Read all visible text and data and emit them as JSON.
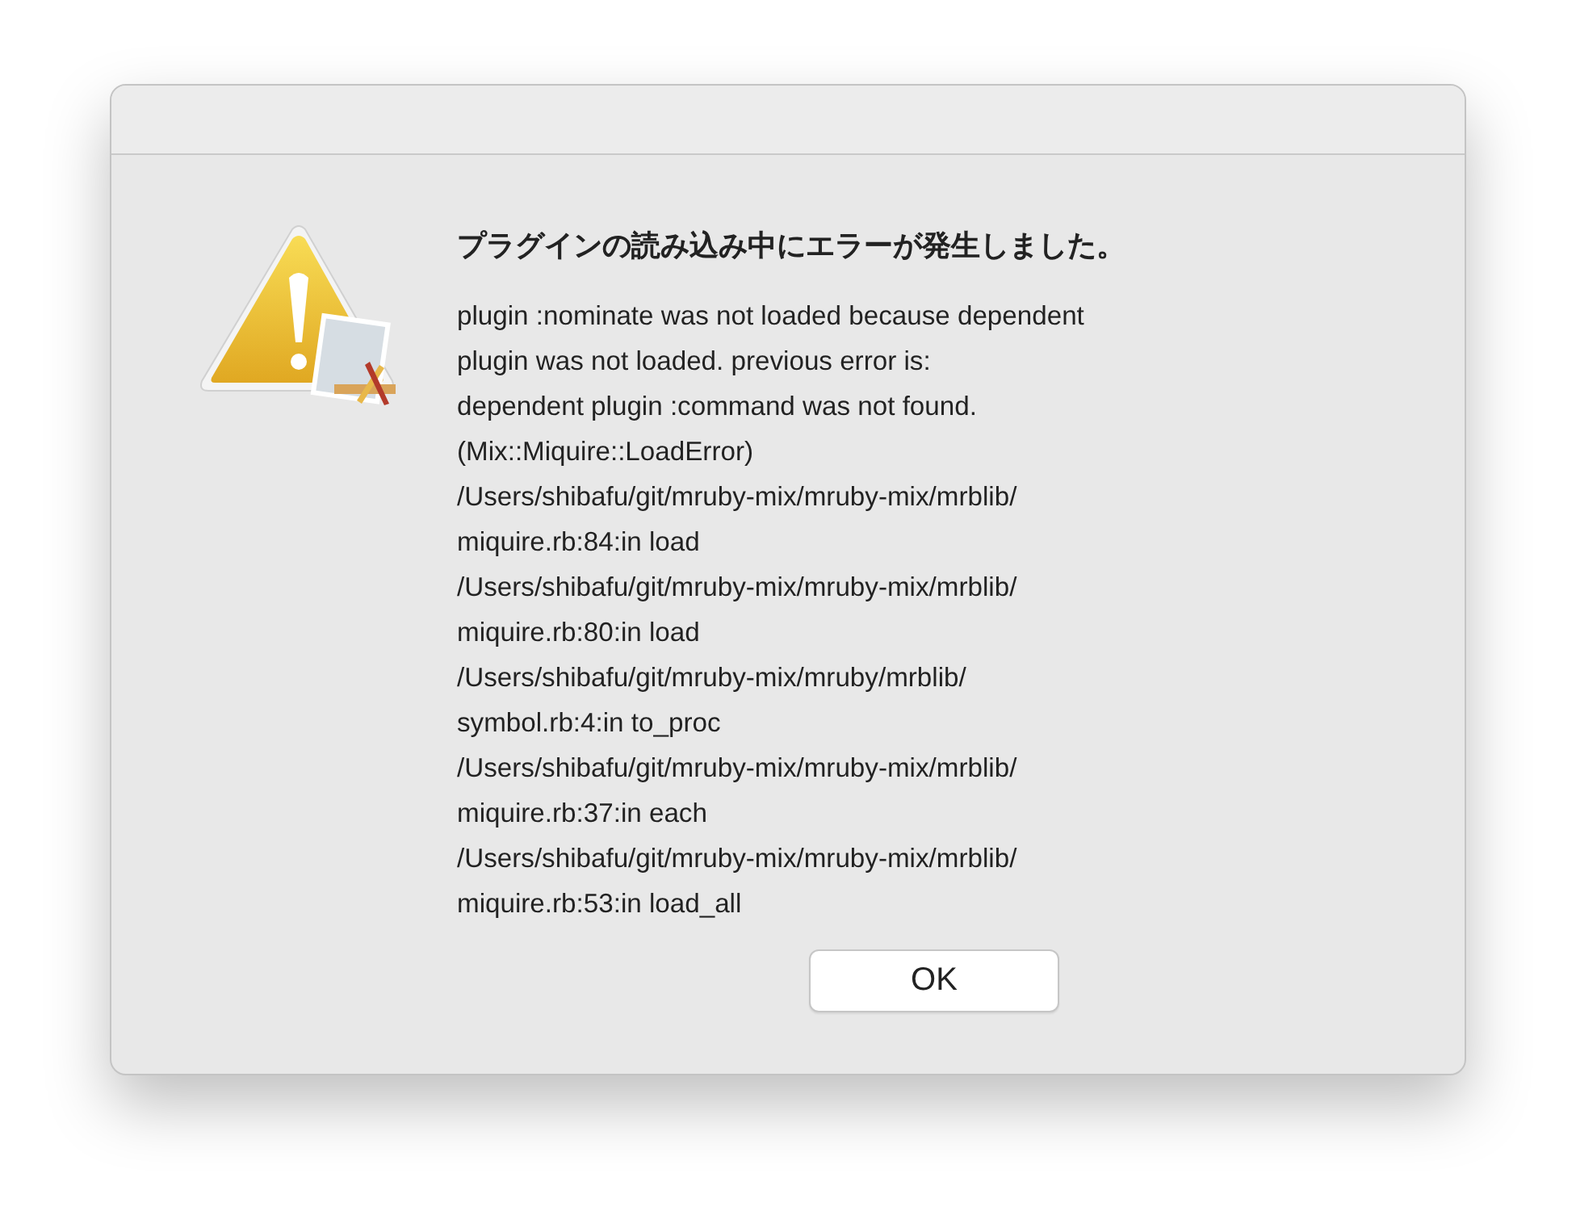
{
  "dialog": {
    "title": "プラグインの読み込み中にエラーが発生しました。",
    "message_lines": [
      "plugin :nominate was not loaded because dependent",
      "plugin was not loaded. previous error is:",
      "dependent plugin :command was not found.",
      "(Mix::Miquire::LoadError)",
      "/Users/shibafu/git/mruby-mix/mruby-mix/mrblib/",
      "miquire.rb:84:in load",
      "/Users/shibafu/git/mruby-mix/mruby-mix/mrblib/",
      "miquire.rb:80:in load",
      "/Users/shibafu/git/mruby-mix/mruby/mrblib/",
      "symbol.rb:4:in to_proc",
      "/Users/shibafu/git/mruby-mix/mruby-mix/mrblib/",
      "miquire.rb:37:in each",
      "/Users/shibafu/git/mruby-mix/mruby-mix/mrblib/",
      "miquire.rb:53:in load_all"
    ],
    "buttons": [
      "OK"
    ]
  }
}
